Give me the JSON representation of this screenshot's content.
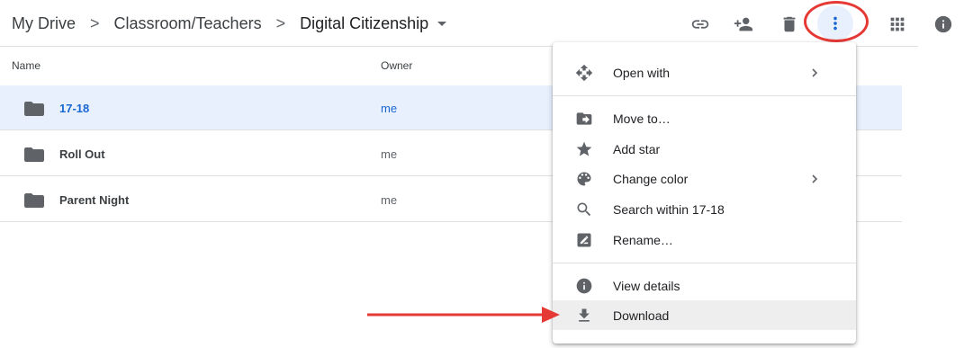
{
  "breadcrumb": {
    "items": [
      "My Drive",
      "Classroom/Teachers",
      "Digital Citizenship"
    ],
    "separator": ">"
  },
  "toolbar": {
    "icons": [
      "link-icon",
      "add-person-icon",
      "trash-icon",
      "more-vert-icon",
      "grid-view-icon",
      "info-icon"
    ]
  },
  "table": {
    "columns": {
      "name": "Name",
      "owner": "Owner"
    },
    "rows": [
      {
        "name": "17-18",
        "owner": "me",
        "selected": true
      },
      {
        "name": "Roll Out",
        "owner": "me",
        "selected": false
      },
      {
        "name": "Parent Night",
        "owner": "me",
        "selected": false
      }
    ]
  },
  "menu": {
    "items": [
      {
        "label": "Open with",
        "icon": "open-with-icon",
        "submenu": true
      },
      {
        "label": "Move to…",
        "icon": "move-to-icon",
        "submenu": false
      },
      {
        "label": "Add star",
        "icon": "star-icon",
        "submenu": false
      },
      {
        "label": "Change color",
        "icon": "palette-icon",
        "submenu": true
      },
      {
        "label": "Search within 17-18",
        "icon": "search-icon",
        "submenu": false
      },
      {
        "label": "Rename…",
        "icon": "rename-icon",
        "submenu": false
      },
      {
        "label": "View details",
        "icon": "info-icon",
        "submenu": false
      },
      {
        "label": "Download",
        "icon": "download-icon",
        "submenu": false,
        "highlighted": true
      }
    ]
  },
  "colors": {
    "accent": "#1967d2",
    "selected_row": "#e8f0fe",
    "annotation": "#e53935",
    "icon": "#5f6368"
  }
}
